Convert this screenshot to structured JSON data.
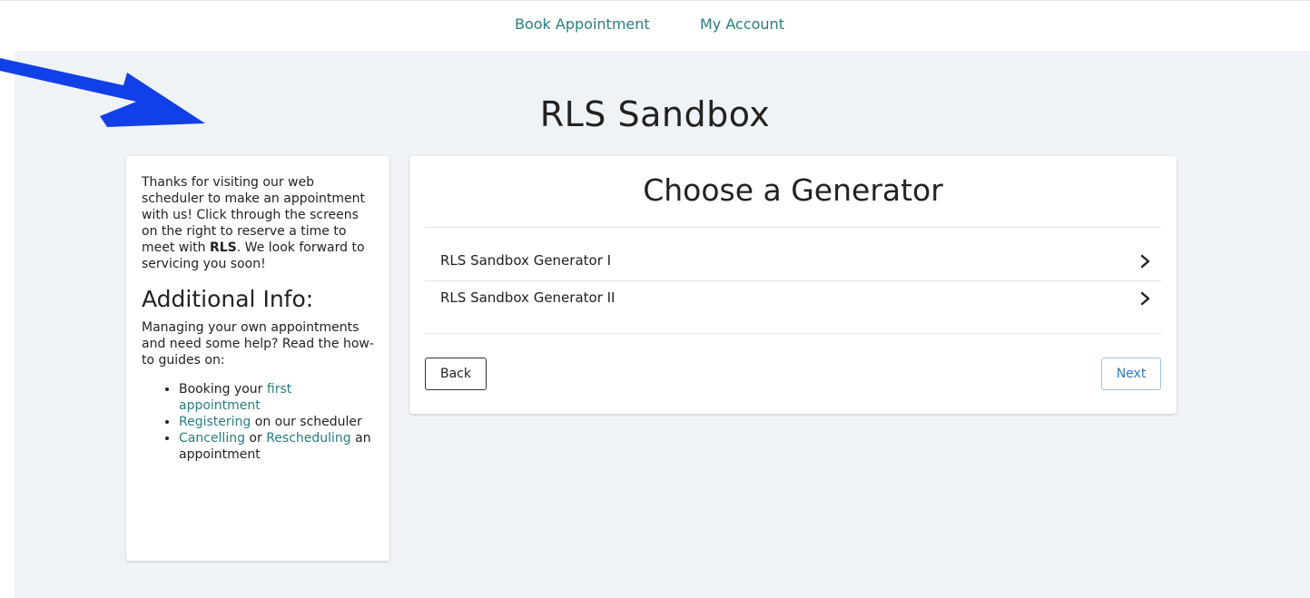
{
  "nav": {
    "items": [
      {
        "label": "Book Appointment"
      },
      {
        "label": "My Account"
      }
    ]
  },
  "page": {
    "title": "RLS Sandbox"
  },
  "sidebar": {
    "intro_before": "Thanks for visiting our web scheduler to make an appointment with us! Click through the screens on the right to reserve a time to meet with ",
    "intro_bold": "RLS",
    "intro_after": ". We look forward to servicing you soon!",
    "heading": "Additional Info:",
    "help_text": "Managing your own appointments and need some help? Read the how-to guides on:",
    "guides": [
      {
        "before": "Booking your ",
        "link": "first appointment",
        "after": ""
      },
      {
        "before": "",
        "link": "Registering",
        "after": " on our scheduler"
      },
      {
        "before": "",
        "link": "Cancelling",
        "mid": " or ",
        "link2": "Rescheduling",
        "after": " an appointment"
      }
    ]
  },
  "generators": {
    "title": "Choose a Generator",
    "items": [
      {
        "label": "RLS Sandbox Generator I"
      },
      {
        "label": "RLS Sandbox Generator II"
      }
    ],
    "back_label": "Back",
    "next_label": "Next"
  },
  "colors": {
    "link": "#2a7d82",
    "background": "#f0f3f6",
    "arrow": "#1240e8",
    "next_text": "#2f78c4"
  },
  "icons": {
    "row_chevron": "chevron-right-icon",
    "annotation": "arrow-annotation-icon"
  }
}
